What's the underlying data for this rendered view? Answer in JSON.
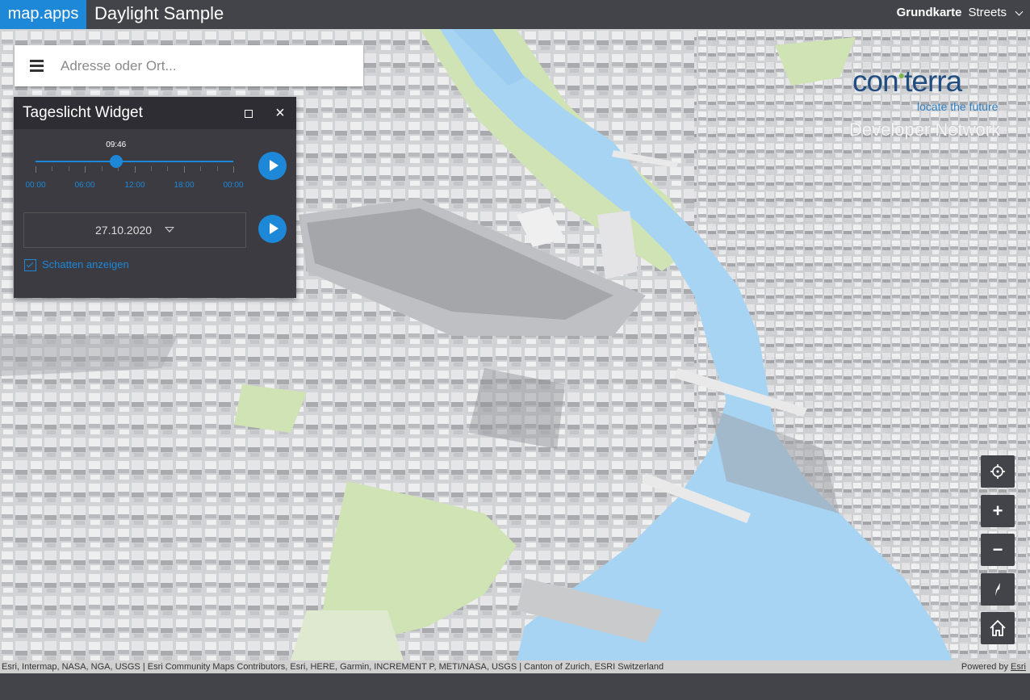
{
  "header": {
    "brand": "map.apps",
    "app_title": "Daylight Sample",
    "basemap_label": "Grundkarte",
    "basemap_value": "Streets"
  },
  "search": {
    "placeholder": "Adresse oder Ort..."
  },
  "widget": {
    "title": "Tageslicht Widget",
    "time_value": "09:46",
    "tick_labels": [
      "00:00",
      "06:00",
      "12:00",
      "18:00",
      "00:00"
    ],
    "time_progress": 0.407,
    "date_value": "27.10.2020",
    "shadow_label": "Schatten anzeigen",
    "shadow_checked": true
  },
  "branding": {
    "logo_text_left": "con",
    "logo_text_right": "terra",
    "logo_tagline": "locate the future",
    "developer_network": "Developer Network"
  },
  "attribution": {
    "sources": "Esri, Intermap, NASA, NGA, USGS | Esri Community Maps Contributors, Esri, HERE, Garmin, INCREMENT P, METI/NASA, USGS | Canton of Zurich, ESRI Switzerland",
    "powered_by": "Powered by",
    "powered_by_link": "Esri"
  },
  "nav": {
    "zoom_in": "+",
    "zoom_out": "−"
  },
  "colors": {
    "accent": "#1e88d8",
    "topbar": "#43434a",
    "widget_bg": "#3b3b41",
    "water": "#a8d4f4",
    "park": "#cfe3b4"
  },
  "icons": [
    "menu-icon",
    "maximize-icon",
    "close-icon",
    "play-icon",
    "caret-down-icon",
    "checkbox-icon",
    "locate-icon",
    "zoom-in-icon",
    "zoom-out-icon",
    "compass-icon",
    "home-icon",
    "chevron-down-icon"
  ]
}
